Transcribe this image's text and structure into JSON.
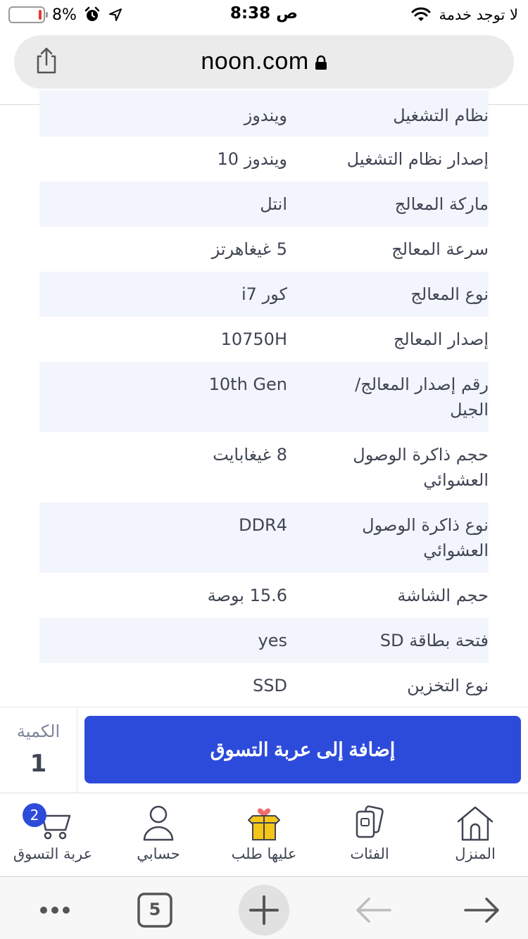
{
  "status_bar": {
    "battery_percent": "8%",
    "battery_level": 0.08,
    "time": "8:38 ص",
    "carrier": "لا توجد خدمة"
  },
  "browser": {
    "url": "noon.com"
  },
  "specs": [
    {
      "label": "نظام التشغيل",
      "value": "ويندوز"
    },
    {
      "label": "إصدار نظام التشغيل",
      "value": "ويندوز 10"
    },
    {
      "label": "ماركة المعالج",
      "value": "انتل"
    },
    {
      "label": "سرعة المعالج",
      "value": "5 غيغاهرتز"
    },
    {
      "label": "نوع المعالج",
      "value": "كور i7"
    },
    {
      "label": "إصدار المعالج",
      "value": "10750H"
    },
    {
      "label": "رقم إصدار المعالج/ الجيل",
      "value": "10th Gen"
    },
    {
      "label": "حجم ذاكرة الوصول العشوائي",
      "value": "8 غيغابايت"
    },
    {
      "label": "نوع ذاكرة الوصول العشوائي",
      "value": "DDR4"
    },
    {
      "label": "حجم الشاشة",
      "value": "15.6 بوصة"
    },
    {
      "label": "فتحة بطاقة SD",
      "value": "yes"
    },
    {
      "label": "نوع التخزين",
      "value": "SSD"
    }
  ],
  "cart_bar": {
    "quantity_label": "الكمية",
    "quantity_value": "1",
    "add_to_cart_label": "إضافة إلى عربة التسوق"
  },
  "bottom_nav": {
    "items": [
      {
        "label": "عربة التسوق",
        "icon": "cart-icon",
        "badge": "2"
      },
      {
        "label": "حسابي",
        "icon": "account-icon"
      },
      {
        "label": "عليها طلب",
        "icon": "gift-box-icon"
      },
      {
        "label": "الفئات",
        "icon": "categories-icon"
      },
      {
        "label": "المنزل",
        "icon": "home-icon"
      }
    ]
  },
  "safari_toolbar": {
    "tab_count": "5"
  },
  "colors": {
    "primary": "#2d4bdb",
    "row_shade": "#f3f5fd",
    "text": "#404553",
    "gift_yellow": "#f5c518",
    "heart_red": "#f26b6b"
  }
}
